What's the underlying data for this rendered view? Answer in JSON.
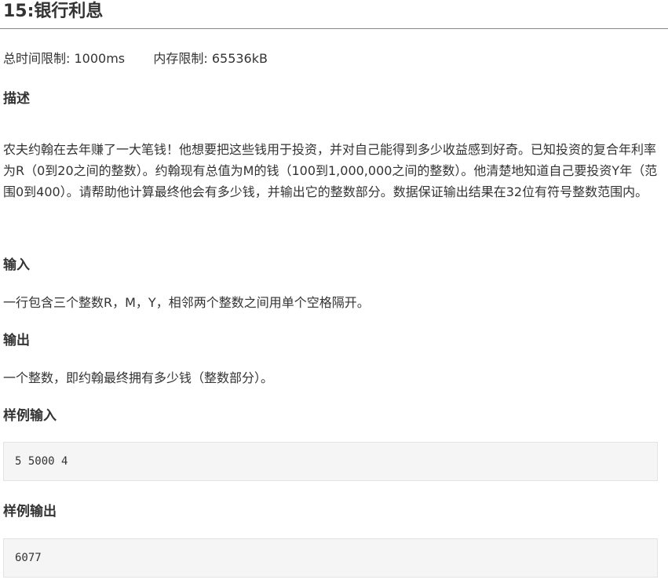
{
  "problem": {
    "title": "15:银行利息",
    "time_limit_label": "总时间限制:",
    "time_limit_value": "1000ms",
    "memory_limit_label": "内存限制:",
    "memory_limit_value": "65536kB"
  },
  "sections": {
    "description": {
      "heading": "描述",
      "text": "农夫约翰在去年赚了一大笔钱！他想要把这些钱用于投资，并对自己能得到多少收益感到好奇。已知投资的复合年利率为R（0到20之间的整数）。约翰现有总值为M的钱（100到1,000,000之间的整数）。他清楚地知道自己要投资Y年（范围0到400）。请帮助他计算最终他会有多少钱，并输出它的整数部分。数据保证输出结果在32位有符号整数范围内。"
    },
    "input": {
      "heading": "输入",
      "text": "一行包含三个整数R，M，Y，相邻两个整数之间用单个空格隔开。"
    },
    "output": {
      "heading": "输出",
      "text": "一个整数，即约翰最终拥有多少钱（整数部分）。"
    },
    "sample_input": {
      "heading": "样例输入",
      "content": "5 5000 4"
    },
    "sample_output": {
      "heading": "样例输出",
      "content": "6077"
    }
  }
}
